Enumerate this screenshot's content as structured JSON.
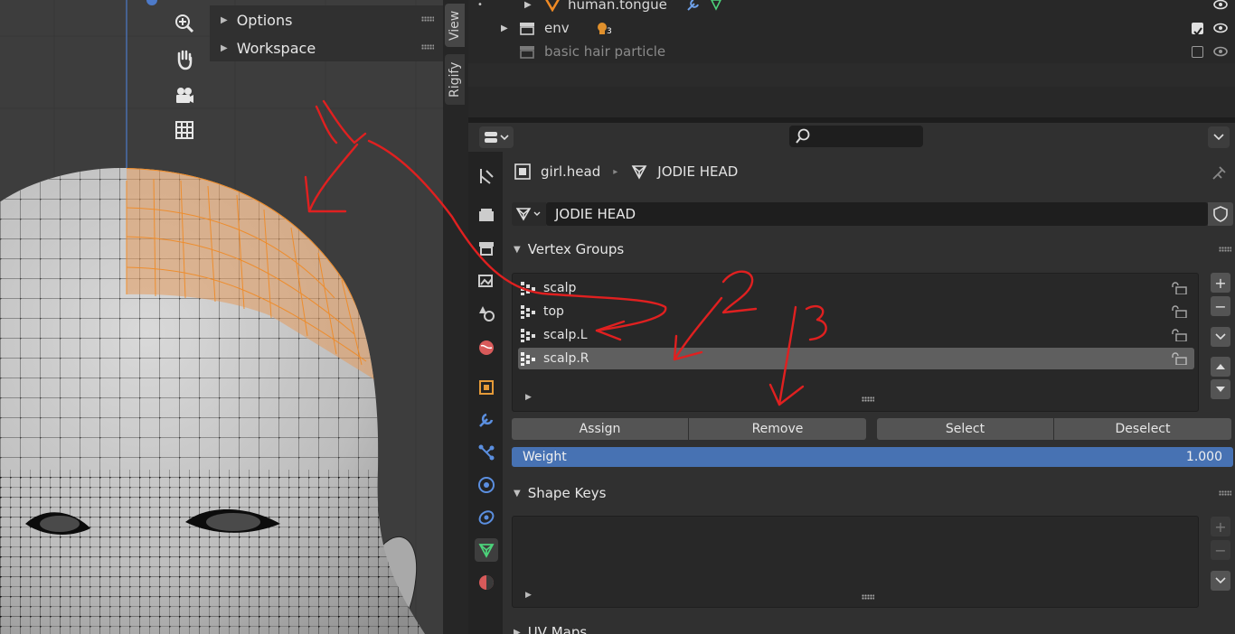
{
  "viewport": {
    "n_panel": {
      "options_label": "Options",
      "workspace_label": "Workspace"
    },
    "side_tabs": {
      "view_label": "View",
      "rigify_label": "Rigify"
    },
    "nav_icons": [
      "zoom-icon",
      "hand-pan-icon",
      "camera-icon",
      "grid-icon"
    ]
  },
  "outliner": {
    "rows": [
      {
        "label": "human.tongue",
        "icon": "mesh-icon",
        "expander": "▶",
        "checkbox": false,
        "visible": true
      },
      {
        "label": "env",
        "icon": "collection-icon",
        "expander": "▶",
        "badge": "3",
        "checkbox": true,
        "visible": true
      },
      {
        "label": "basic hair particle",
        "icon": "collection-icon",
        "expander": "",
        "checkbox": false,
        "visible": true,
        "dimmed": true
      }
    ]
  },
  "properties": {
    "breadcrumb": {
      "object": "girl.head",
      "mesh": "JODIE HEAD"
    },
    "mesh_name": "JODIE HEAD",
    "vertex_groups": {
      "title": "Vertex Groups",
      "items": [
        {
          "label": "scalp",
          "selected": false
        },
        {
          "label": "top",
          "selected": false
        },
        {
          "label": "scalp.L",
          "selected": false
        },
        {
          "label": "scalp.R",
          "selected": true
        }
      ],
      "assign_label": "Assign",
      "remove_label": "Remove",
      "select_label": "Select",
      "deselect_label": "Deselect",
      "weight_label": "Weight",
      "weight_value": "1.000"
    },
    "shape_keys": {
      "title": "Shape Keys"
    },
    "uv_maps": {
      "title": "UV Maps"
    }
  },
  "annotations": {
    "color": "#e02020",
    "numbers": [
      "1",
      "2",
      "3"
    ]
  },
  "colors": {
    "accent_blue": "#4772b3",
    "selection_orange": "#f08a24"
  }
}
